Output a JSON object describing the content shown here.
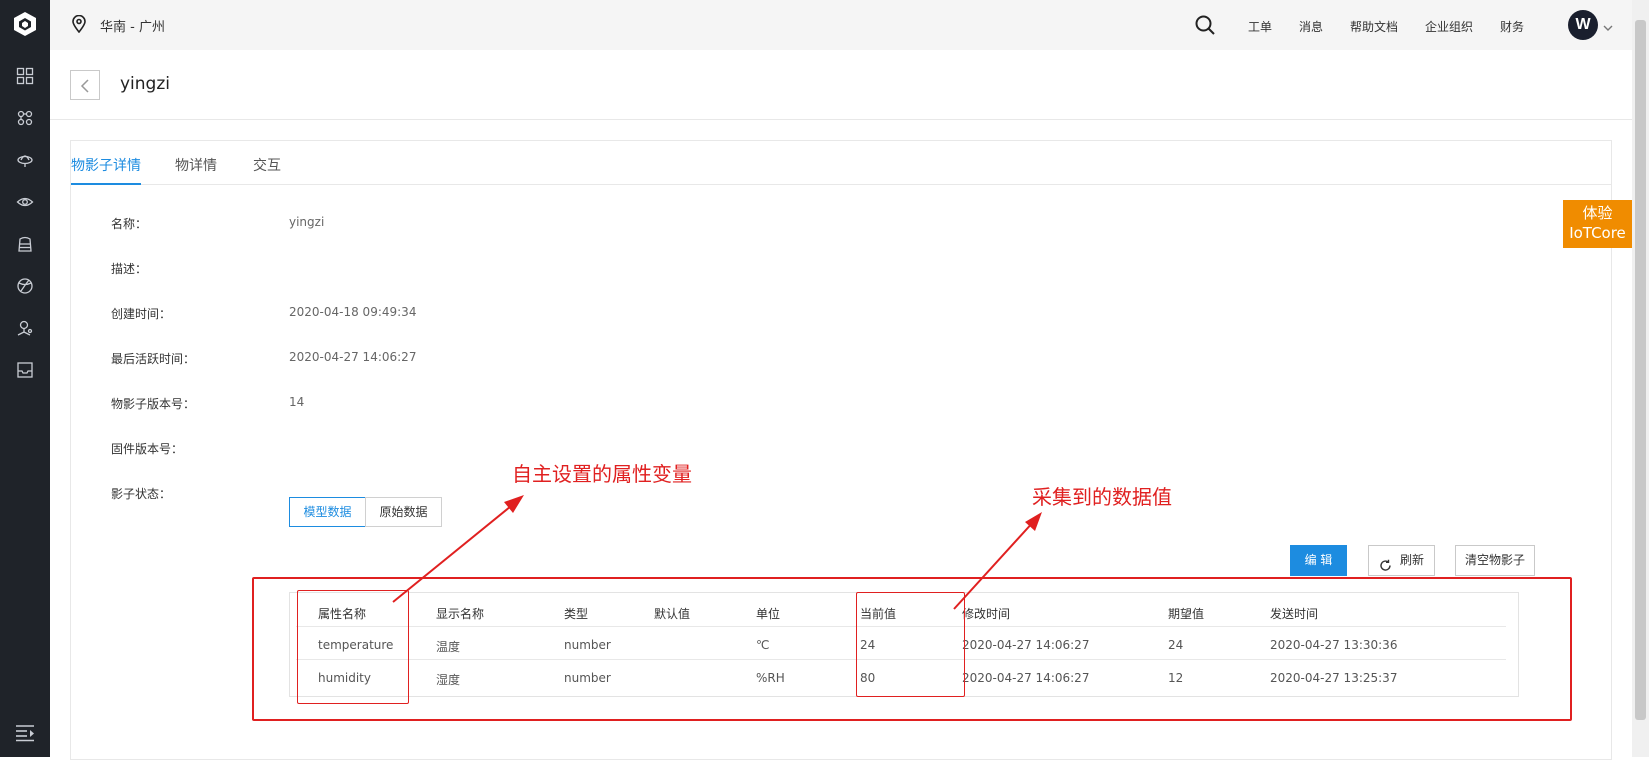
{
  "header": {
    "region": "华南 - 广州",
    "menu": [
      "工单",
      "消息",
      "帮助文档",
      "企业组织",
      "财务"
    ],
    "avatar_initial": "W"
  },
  "page": {
    "title": "yingzi",
    "tabs": [
      "物影子详情",
      "物详情",
      "交互"
    ]
  },
  "details": {
    "name_label": "名称：",
    "name_value": "yingzi",
    "desc_label": "描述：",
    "desc_value": "",
    "created_label": "创建时间：",
    "created_value": "2020-04-18 09:49:34",
    "active_label": "最后活跃时间：",
    "active_value": "2020-04-27 14:06:27",
    "shadow_ver_label": "物影子版本号：",
    "shadow_ver_value": "14",
    "firmware_label": "固件版本号：",
    "firmware_value": "",
    "shadow_state_label": "影子状态：",
    "seg_model": "模型数据",
    "seg_raw": "原始数据"
  },
  "actions": {
    "edit": "编 辑",
    "refresh": "刷新",
    "clear": "清空物影子"
  },
  "table": {
    "headers": [
      "属性名称",
      "显示名称",
      "类型",
      "默认值",
      "单位",
      "当前值",
      "修改时间",
      "期望值",
      "发送时间"
    ],
    "rows": [
      [
        "temperature",
        "温度",
        "number",
        "",
        "℃",
        "24",
        "2020-04-27 14:06:27",
        "24",
        "2020-04-27 13:30:36"
      ],
      [
        "humidity",
        "湿度",
        "number",
        "",
        "%RH",
        "80",
        "2020-04-27 14:06:27",
        "12",
        "2020-04-27 13:25:37"
      ]
    ]
  },
  "annotations": {
    "note1": "自主设置的属性变量",
    "note2": "采集到的数据值"
  },
  "promo": {
    "line1": "体验",
    "line2": "IoTCore",
    "color": "#f08c00"
  },
  "colors": {
    "accent": "#1d8ce0",
    "sidebar": "#1f2329",
    "annotation": "#e02020"
  }
}
